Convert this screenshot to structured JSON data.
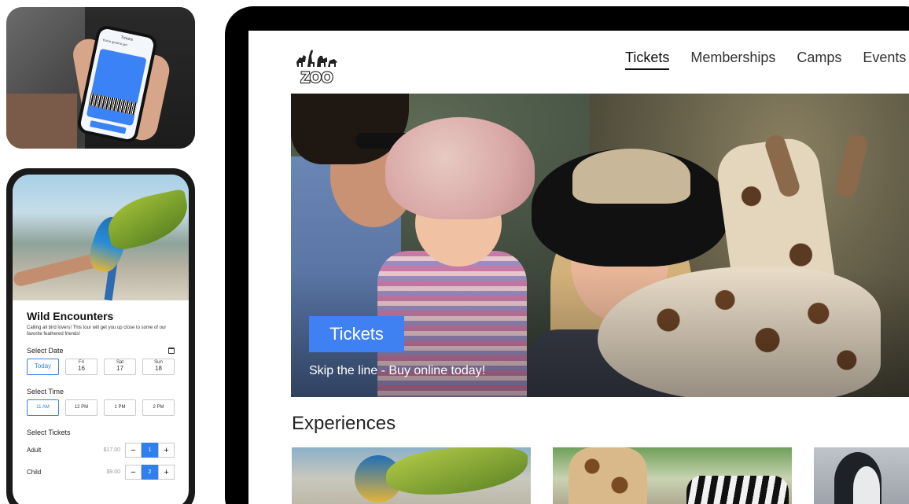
{
  "phone_ticket": {
    "title": "Tickets",
    "subtitle": "You're good to go!"
  },
  "wild": {
    "title": "Wild Encounters",
    "description": "Calling all bird lovers! This tour will get you up close to some of our favorite feathered friends!",
    "date_label": "Select Date",
    "dates": [
      {
        "day": "Today",
        "num": ""
      },
      {
        "day": "Fri",
        "num": "16"
      },
      {
        "day": "Sat",
        "num": "17"
      },
      {
        "day": "Sun",
        "num": "18"
      }
    ],
    "time_label": "Select Time",
    "times": [
      "11 AM",
      "12 PM",
      "1 PM",
      "2 PM"
    ],
    "tickets_label": "Select Tickets",
    "tickets": [
      {
        "name": "Adult",
        "price": "$17.00",
        "qty": "1"
      },
      {
        "name": "Child",
        "price": "$9.00",
        "qty": "2"
      }
    ],
    "minus": "−",
    "plus": "+"
  },
  "site": {
    "logo_text": "ZOO",
    "nav": [
      "Tickets",
      "Memberships",
      "Camps",
      "Events"
    ],
    "active_nav": "Tickets",
    "hero": {
      "button": "Tickets",
      "tagline": "Skip the line - Buy online today!"
    },
    "experiences_title": "Experiences"
  },
  "colors": {
    "accent": "#3f80f3",
    "tablet_frame": "#000000"
  },
  "icons": [
    "calendar-icon",
    "zoo-logo-icon"
  ]
}
